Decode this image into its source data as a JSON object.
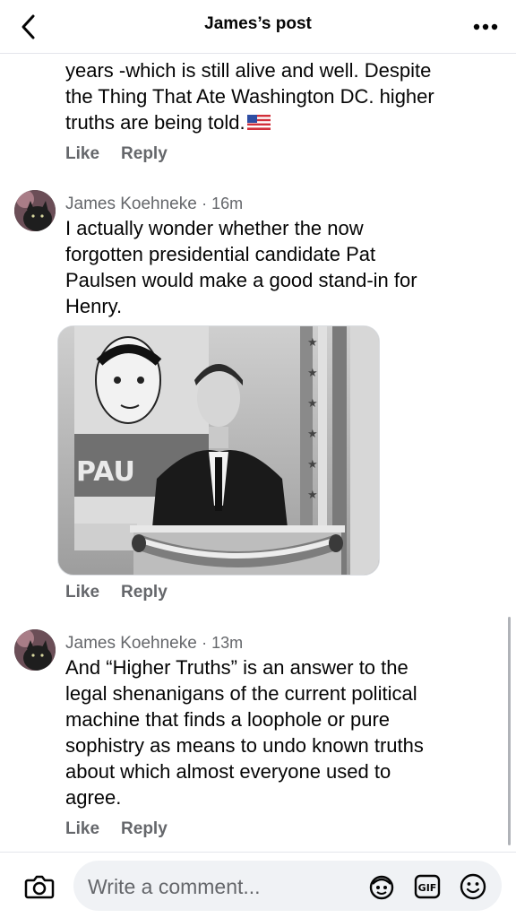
{
  "header": {
    "title": "James’s post"
  },
  "comments": [
    {
      "text_lines": [
        "years -which is still alive and well. Despite",
        "the Thing That Ate Washington DC. higher",
        "truths are being told."
      ],
      "like_label": "Like",
      "reply_label": "Reply"
    },
    {
      "author": "James Koehneke",
      "time": "· 16m",
      "text_lines": [
        "I actually wonder whether the now",
        "forgotten presidential candidate Pat",
        "Paulsen would make a good stand-in for",
        "Henry."
      ],
      "photo_sign_text": "PAU",
      "like_label": "Like",
      "reply_label": "Reply"
    },
    {
      "author": "James Koehneke",
      "time": "· 13m",
      "text_lines": [
        "And “Higher Truths” is an answer to the",
        "legal shenanigans of the current political",
        "machine that finds a loophole or pure",
        "sophistry as means to undo known truths",
        "about which almost everyone used to",
        "agree."
      ],
      "like_label": "Like",
      "reply_label": "Reply"
    }
  ],
  "composer": {
    "placeholder": "Write a comment..."
  },
  "icons": {
    "back": "chevron-left-icon",
    "more": "more-dots-icon",
    "camera": "camera-icon",
    "avatar_sticker": "avatar-sticker-icon",
    "gif": "gif-icon",
    "emoji": "emoji-icon",
    "flag": "us-flag-icon"
  },
  "colors": {
    "secondary_text": "#65676b",
    "input_bg": "#f0f2f5"
  }
}
